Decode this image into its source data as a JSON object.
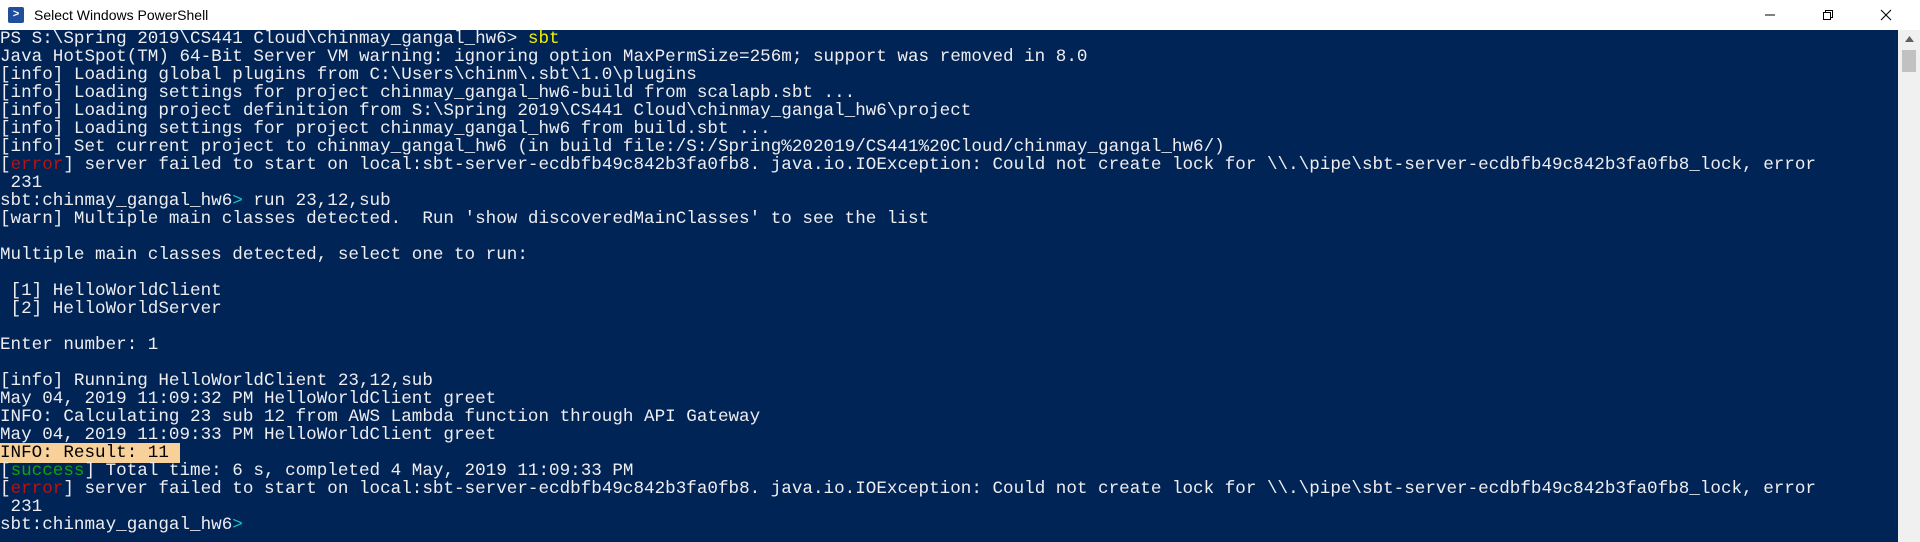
{
  "window": {
    "title": "Select Windows PowerShell",
    "app_icon": "powershell-icon",
    "app_icon_glyph": ">",
    "buttons": [
      "minimize-icon",
      "maximize-icon",
      "close-icon"
    ]
  },
  "colors": {
    "background": "#012456",
    "foreground": "#eeedf0",
    "command": "#f3f200",
    "prompt_arrow": "#1ac6c6",
    "error": "#b41414",
    "success": "#13a10e",
    "highlight": "#f7d09a"
  },
  "console": {
    "lines": [
      [
        {
          "t": "PS S:\\Spring 2019\\CS441 Cloud\\chinmay_gangal_hw6> "
        },
        {
          "t": "sbt",
          "c": "yellow"
        }
      ],
      [
        {
          "t": "Java HotSpot(TM) 64-Bit Server VM warning: ignoring option MaxPermSize=256m; support was removed in 8.0"
        }
      ],
      [
        {
          "t": "[info] Loading global plugins from C:\\Users\\chinm\\.sbt\\1.0\\plugins"
        }
      ],
      [
        {
          "t": "[info] Loading settings for project chinmay_gangal_hw6-build from scalapb.sbt ..."
        }
      ],
      [
        {
          "t": "[info] Loading project definition from S:\\Spring 2019\\CS441 Cloud\\chinmay_gangal_hw6\\project"
        }
      ],
      [
        {
          "t": "[info] Loading settings for project chinmay_gangal_hw6 from build.sbt ..."
        }
      ],
      [
        {
          "t": "[info] Set current project to chinmay_gangal_hw6 (in build file:/S:/Spring%202019/CS441%20Cloud/chinmay_gangal_hw6/)"
        }
      ],
      [
        {
          "t": "["
        },
        {
          "t": "error",
          "c": "red"
        },
        {
          "t": "] server failed to start on local:sbt-server-ecdbfb49c842b3fa0fb8. java.io.IOException: Could not create lock for \\\\.\\pipe\\sbt-server-ecdbfb49c842b3fa0fb8_lock, error"
        }
      ],
      [
        {
          "t": " 231"
        }
      ],
      [
        {
          "t": "sbt:chinmay_gangal_hw6"
        },
        {
          "t": ">",
          "c": "cyan"
        },
        {
          "t": " run 23,12,sub"
        }
      ],
      [
        {
          "t": "[warn] Multiple main classes detected.  Run 'show discoveredMainClasses' to see the list"
        }
      ],
      [
        {
          "t": ""
        }
      ],
      [
        {
          "t": "Multiple main classes detected, select one to run:"
        }
      ],
      [
        {
          "t": ""
        }
      ],
      [
        {
          "t": " [1] HelloWorldClient"
        }
      ],
      [
        {
          "t": " [2] HelloWorldServer"
        }
      ],
      [
        {
          "t": ""
        }
      ],
      [
        {
          "t": "Enter number: 1"
        }
      ],
      [
        {
          "t": ""
        }
      ],
      [
        {
          "t": "[info] Running HelloWorldClient 23,12,sub"
        }
      ],
      [
        {
          "t": "May 04, 2019 11:09:32 PM HelloWorldClient greet"
        }
      ],
      [
        {
          "t": "INFO: Calculating 23 sub 12 from AWS Lambda function through API Gateway"
        }
      ],
      [
        {
          "t": "May 04, 2019 11:09:33 PM HelloWorldClient greet"
        }
      ],
      [
        {
          "t": "INFO: Result: 11 ",
          "c": "hl"
        }
      ],
      [
        {
          "t": "["
        },
        {
          "t": "success",
          "c": "green"
        },
        {
          "t": "] Total time: 6 s, completed 4 May, 2019 11:09:33 PM"
        }
      ],
      [
        {
          "t": "["
        },
        {
          "t": "error",
          "c": "red"
        },
        {
          "t": "] server failed to start on local:sbt-server-ecdbfb49c842b3fa0fb8. java.io.IOException: Could not create lock for \\\\.\\pipe\\sbt-server-ecdbfb49c842b3fa0fb8_lock, error"
        }
      ],
      [
        {
          "t": " 231"
        }
      ],
      [
        {
          "t": "sbt:chinmay_gangal_hw6"
        },
        {
          "t": ">",
          "c": "cyan"
        }
      ]
    ]
  }
}
